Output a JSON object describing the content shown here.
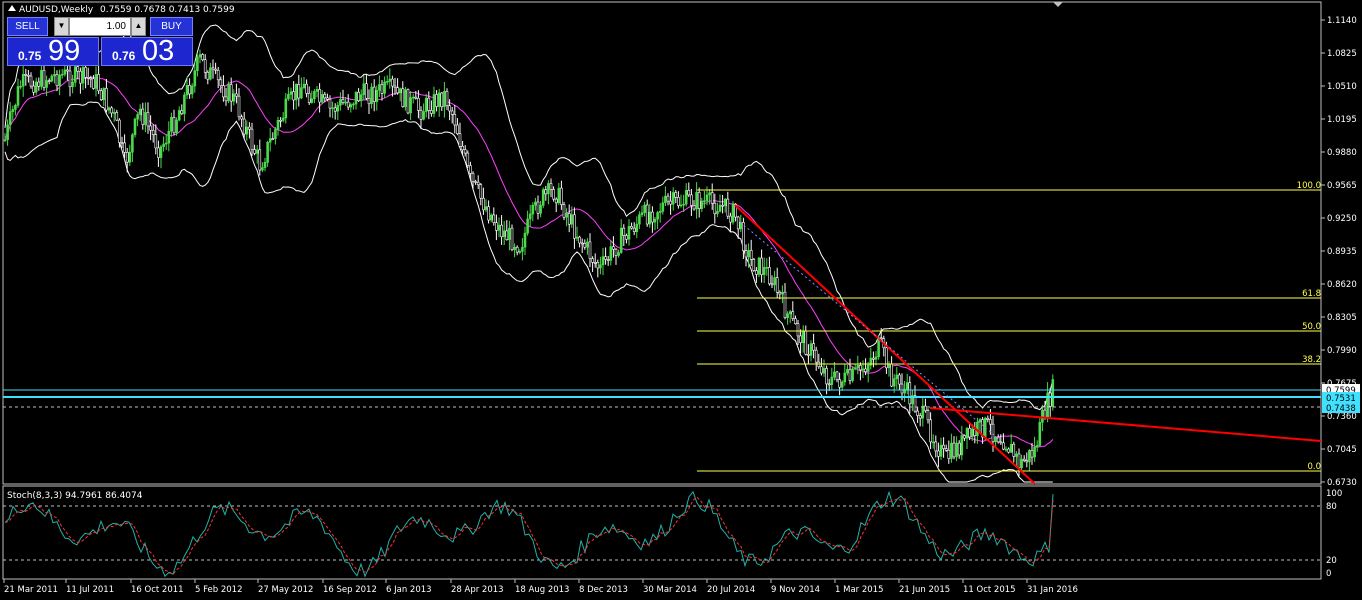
{
  "header": {
    "symbol_label": "AUDUSD,Weekly",
    "ohlc": "0.7559 0.7678 0.7413 0.7599"
  },
  "trade_panel": {
    "sell_label": "SELL",
    "buy_label": "BUY",
    "lot_value": "1.00",
    "bid_prefix": "0.75",
    "bid_big": "99",
    "ask_prefix": "0.76",
    "ask_big": "03"
  },
  "indicator": {
    "label": "Stoch(8,3,3) 94.7961 86.4074",
    "levels": [
      "100",
      "80",
      "20",
      "0"
    ]
  },
  "price_axis": {
    "ticks": [
      "1.1140",
      "1.0825",
      "1.0510",
      "1.0195",
      "0.9880",
      "0.9565",
      "0.9250",
      "0.8935",
      "0.8620",
      "0.8305",
      "0.7990",
      "0.7675",
      "0.7360",
      "0.7045",
      "0.6730"
    ],
    "tags": [
      "0.7599",
      "0.7531",
      "0.7438"
    ]
  },
  "fibonacci": {
    "levels": [
      "100.0",
      "61.8",
      "50.0",
      "38.2",
      "0.0"
    ]
  },
  "time_axis": {
    "labels": [
      "21 Mar 2011",
      "11 Jul 2011",
      "16 Oct 2011",
      "5 Feb 2012",
      "27 May 2012",
      "16 Sep 2012",
      "6 Jan 2013",
      "28 Apr 2013",
      "18 Aug 2013",
      "8 Dec 2013",
      "30 Mar 2014",
      "20 Jul 2014",
      "9 Nov 2014",
      "1 Mar 2015",
      "21 Jun 2015",
      "11 Oct 2015",
      "31 Jan 2016"
    ]
  },
  "colors": {
    "bull_candle": "#4cd94c",
    "bear_candle": "#ffffff",
    "bollinger": "#ffffff",
    "moving_average": "#ff40ff",
    "fib": "#ffff4a",
    "trendline": "#ff0000",
    "support": "#40e0ff",
    "stoch_main": "#20b2aa",
    "stoch_signal": "#ff3030"
  }
}
